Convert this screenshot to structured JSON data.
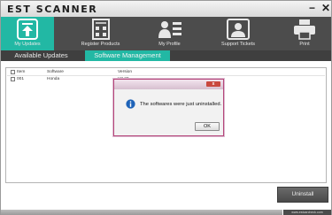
{
  "window": {
    "title": "EST SCANNER",
    "minimize_glyph": "−",
    "close_glyph": "✕"
  },
  "toolbar": {
    "items": [
      {
        "label": "My Updates",
        "icon": "upload-icon",
        "active": true
      },
      {
        "label": "Register Products",
        "icon": "register-icon",
        "active": false
      },
      {
        "label": "My Profile",
        "icon": "profile-icon",
        "active": false
      },
      {
        "label": "Support Tickets",
        "icon": "support-icon",
        "active": false
      },
      {
        "label": "Print",
        "icon": "printer-icon",
        "active": false
      }
    ]
  },
  "subnav": {
    "tabs": [
      {
        "label": "Available Updates",
        "active": false
      },
      {
        "label": "Software Management",
        "active": true
      }
    ]
  },
  "table": {
    "columns": [
      "Item",
      "Software",
      "Version"
    ],
    "rows": [
      {
        "item": "001",
        "software": "Honda",
        "version": "V3.20"
      }
    ]
  },
  "dialog": {
    "message": "The softwares were just uninstalled.",
    "ok_label": "OK",
    "close_glyph": "x",
    "icon": "info-icon"
  },
  "actions": {
    "uninstall_label": "Uninstall"
  },
  "footer": {
    "website": "www.estcarcheck.com"
  },
  "colors": {
    "accent": "#22b8a4",
    "toolbar_bg": "#4c4c4c",
    "dialog_border": "#b5467a",
    "dialog_close": "#c9483f"
  }
}
